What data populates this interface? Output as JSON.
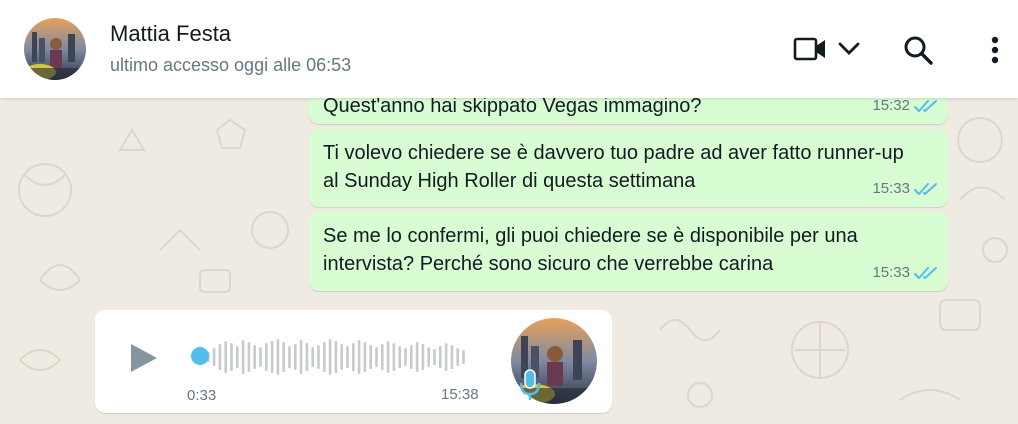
{
  "header": {
    "contact_name": "Mattia Festa",
    "last_seen": "ultimo accesso oggi alle 06:53",
    "icons": [
      "video-call-icon",
      "chevron-down-icon",
      "search-icon",
      "menu-dots-icon"
    ]
  },
  "messages": [
    {
      "direction": "out",
      "text": "Quest'anno hai skippato Vegas immagino?",
      "time": "15:32",
      "status": "read"
    },
    {
      "direction": "out",
      "text": "Ti volevo chiedere se è davvero tuo padre ad aver fatto runner-up al Sunday High Roller di questa settimana",
      "time": "15:33",
      "status": "read"
    },
    {
      "direction": "out",
      "text": "Se me lo confermi, gli puoi chiedere se è disponibile per una intervista? Perché sono sicuro che verrebbe carina",
      "time": "15:33",
      "status": "read"
    },
    {
      "direction": "in",
      "type": "voice",
      "duration": "0:33",
      "time": "15:38",
      "progress": 0
    }
  ],
  "colors": {
    "outgoing_bubble": "#d9fdd3",
    "incoming_bubble": "#ffffff",
    "read_ticks": "#53bdeb",
    "chat_background": "#efeae2"
  }
}
